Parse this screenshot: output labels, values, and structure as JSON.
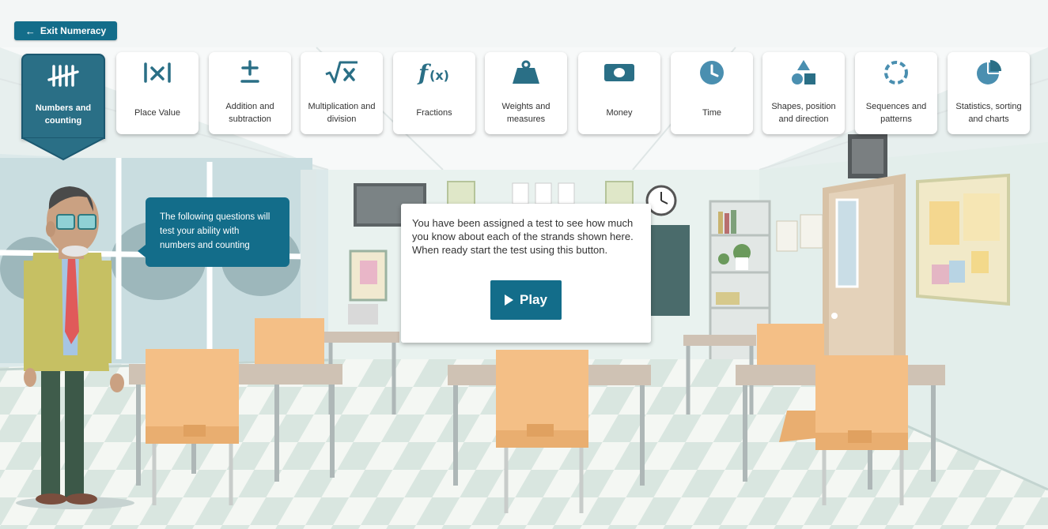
{
  "header": {
    "exit_label": "Exit Numeracy"
  },
  "strands": [
    {
      "label": "Numbers and counting",
      "icon": "tally-marks-icon",
      "active": true
    },
    {
      "label": "Place Value",
      "icon": "place-value-icon",
      "active": false
    },
    {
      "label": "Addition and subtraction",
      "icon": "plus-minus-icon",
      "active": false
    },
    {
      "label": "Multiplication and division",
      "icon": "square-root-icon",
      "active": false
    },
    {
      "label": "Fractions",
      "icon": "function-icon",
      "active": false
    },
    {
      "label": "Weights and measures",
      "icon": "weight-icon",
      "active": false
    },
    {
      "label": "Money",
      "icon": "banknote-icon",
      "active": false
    },
    {
      "label": "Time",
      "icon": "clock-icon",
      "active": false
    },
    {
      "label": "Shapes, position and direction",
      "icon": "shapes-icon",
      "active": false
    },
    {
      "label": "Sequences and patterns",
      "icon": "dotted-circle-icon",
      "active": false
    },
    {
      "label": "Statistics, sorting and charts",
      "icon": "pie-chart-icon",
      "active": false
    }
  ],
  "tutor": {
    "speech": "The following questions will test your ability with numbers and counting"
  },
  "dialog": {
    "message": "You have been assigned a test to see how much you know about each of the strands shown here. When ready start the test using this button.",
    "play_label": "Play"
  },
  "colors": {
    "primary": "#136d8a",
    "active_tab": "#2a6f86",
    "chair": "#f4bf86",
    "desk_top": "#cfc2b4"
  }
}
